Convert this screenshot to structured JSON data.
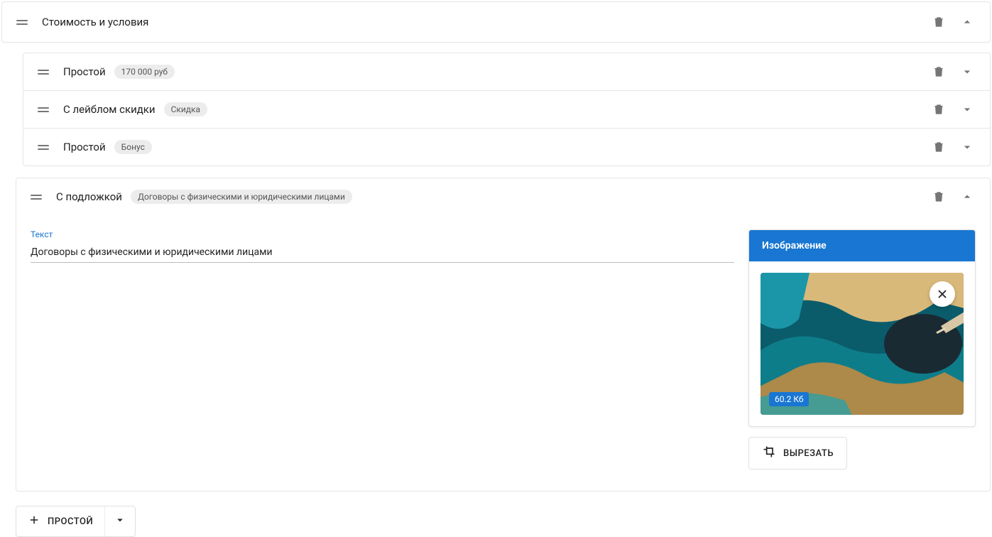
{
  "main": {
    "title": "Стоимость и условия",
    "items": [
      {
        "title": "Простой",
        "badge": "170 000 руб"
      },
      {
        "title": "С лейблом скидки",
        "badge": "Скидка"
      },
      {
        "title": "Простой",
        "badge": "Бонус"
      }
    ],
    "expanded": {
      "title": "С подложкой",
      "badge": "Договоры с физическими и юридическими лицами",
      "text_label": "Текст",
      "text_value": "Договоры с физическими и юридическими лицами",
      "image_label": "Изображение",
      "image_size": "60.2 Кб",
      "crop_label": "ВЫРЕЗАТЬ"
    },
    "add_button": "ПРОСТОЙ"
  }
}
